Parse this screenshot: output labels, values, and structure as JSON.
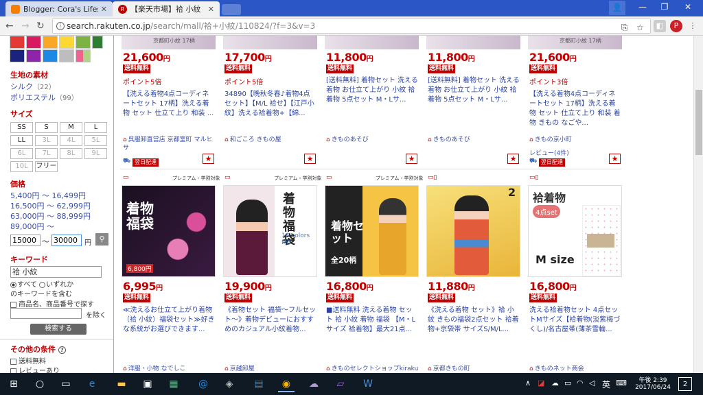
{
  "browser": {
    "tabs": [
      {
        "title": "Blogger: Cora's Lifestyle",
        "favicon": "blogger-icon",
        "color": "#f57d00"
      },
      {
        "title": "【楽天市場】袷 小紋（着物",
        "favicon": "rakuten-icon",
        "color": "#bf0000"
      }
    ],
    "url_host": "search.rakuten.co.jp",
    "url_path": "/search/mall/袷+小紋/110824/?f=3&v=3",
    "window_buttons": [
      "minimize",
      "maximize",
      "close"
    ]
  },
  "sidebar": {
    "material_heading": "生地の素材",
    "materials": [
      {
        "label": "シルク",
        "count": "（22）"
      },
      {
        "label": "ポリエステル",
        "count": "（99）"
      }
    ],
    "size_heading": "サイズ",
    "sizes": [
      {
        "label": "SS",
        "enabled": true
      },
      {
        "label": "S",
        "enabled": true
      },
      {
        "label": "M",
        "enabled": true
      },
      {
        "label": "L",
        "enabled": true
      },
      {
        "label": "LL",
        "enabled": true
      },
      {
        "label": "3L",
        "enabled": false
      },
      {
        "label": "4L",
        "enabled": false
      },
      {
        "label": "5L",
        "enabled": false
      },
      {
        "label": "6L",
        "enabled": false
      },
      {
        "label": "7L",
        "enabled": false
      },
      {
        "label": "8L",
        "enabled": false
      },
      {
        "label": "9L",
        "enabled": false
      },
      {
        "label": "10L",
        "enabled": false
      },
      {
        "label": "フリー",
        "enabled": true
      }
    ],
    "price_heading": "価格",
    "price_ranges": [
      "5,400円 ～ 16,499円",
      "16,500円 ～ 62,999円",
      "63,000円 ～ 88,999円",
      "89,000円 ～"
    ],
    "price_min": "15000",
    "price_sep": "～",
    "price_max": "30000",
    "price_unit": "円",
    "keyword_heading": "キーワード",
    "keyword_value": "袷 小紋",
    "radio_all": "すべて",
    "radio_any": "いずれか",
    "radio_suffix": "のキーワードを含む",
    "check_product_no": "商品名、商品番号で探す",
    "exclude_label": "を除く",
    "search_button": "検索する",
    "other_heading": "その他の条件",
    "free_shipping": "送料無料",
    "with_review": "レビューあり"
  },
  "row1": [
    {
      "price": "21,600",
      "free": "送料無料",
      "point": "ポイント5倍",
      "title": "【洗える着物4点コーディネートセット 17柄】洗える着物 セット 仕立て上り 和装 ...",
      "shop": "呉服卸直営店 京都室町 マルヒサ",
      "delivery": "翌日配達",
      "img_label": "京都町小紋 17柄"
    },
    {
      "price": "17,700",
      "free": "送料無料",
      "point": "ポイント5倍",
      "title": "34890【晩秋冬春♪着物4点セット】【M/L 袷せ】【江戸小紋】洗える袷着物+【綿...",
      "shop": "和ごころ きもの屋",
      "delivery": "",
      "img_label": ""
    },
    {
      "price": "11,800",
      "free": "送料無料",
      "point": "",
      "title": "[送料無料] 着物セット 洗える着物 お仕立て上がり 小紋 袷着物 5点セット M・Lサ...",
      "shop": "きものあそび",
      "delivery": "",
      "img_label": ""
    },
    {
      "price": "11,800",
      "free": "送料無料",
      "point": "",
      "title": "[送料無料] 着物セット 洗える着物 お仕立て上がり 小紋 袷着物 5点セット M・Lサ...",
      "shop": "きものあそび",
      "delivery": "",
      "img_label": ""
    },
    {
      "price": "21,600",
      "free": "送料無料",
      "point": "ポイント3倍",
      "title": "【洗える着物4点コーディネートセット 17柄】洗える着物 セット 仕立て上り 和装 着物 きもの なごや...",
      "shop": "きもの京小町",
      "review": "レビュー(4件)",
      "delivery": "翌日配達",
      "img_label": "京都町小紋 17柄"
    }
  ],
  "row2": [
    {
      "price": "6,995",
      "free": "送料無料",
      "title": "≪洗えるお仕立て上がり着物（袷 小紋）福袋セット≫好きな系統がお選びできます...",
      "shop": "洋服・小物 なでしこ",
      "banner": "プレミアム・学割対象",
      "img_text": "着物福袋",
      "img_sub": "6,800円",
      "bg": "#1a1020"
    },
    {
      "price": "19,900",
      "free": "送料無料",
      "title": "《着物セット 福袋～フルセット～》着物デビューにおすすめのカジュアル小紋着物...",
      "shop": "京越卸屋",
      "banner": "プレミアム・学割対象",
      "img_text": "着物福袋",
      "img_sub": "16 colors M/L",
      "bg": "#ffffff"
    },
    {
      "price": "16,800",
      "free": "送料無料",
      "title": "■送料無料 洗える着物 セット 袷 小紋 着物 福袋 【M・Lサイズ 袷着物】最大21点...",
      "shop": "きものセレクトショップkirakuk",
      "banner": "プレミアム・学割対象",
      "img_text": "着物セット",
      "img_sub": "全20柄",
      "bg": "#2a2a2a"
    },
    {
      "price": "11,880",
      "free": "送料無料",
      "title": "《洗える着物 セット》袷 小紋 きもの福袋2点セット 袷着物+京袋帯 サイズS/M/L...",
      "shop": "京都きもの町",
      "banner": "",
      "img_text": "2",
      "img_sub": "",
      "bg": "#f4d24a"
    },
    {
      "price": "16,800",
      "free": "送料無料",
      "title": "洗える袷着物セット 4点セットMサイズ【袷着物(淡紫梅づくし)/名古屋帯(薄茶雪輪...",
      "shop": "きものネット商会",
      "banner": "",
      "img_text": "袷着物",
      "img_sub": "4点set",
      "img_size": "M size",
      "bg": "#ffffff"
    }
  ],
  "taskbar": {
    "time": "午後 2:39",
    "date": "2017/06/24",
    "ime": "英",
    "notif": "2"
  },
  "colors": {
    "rakuten_red": "#bf0000",
    "link_blue": "#2b45a6",
    "tab_blue": "#2a57c5"
  }
}
